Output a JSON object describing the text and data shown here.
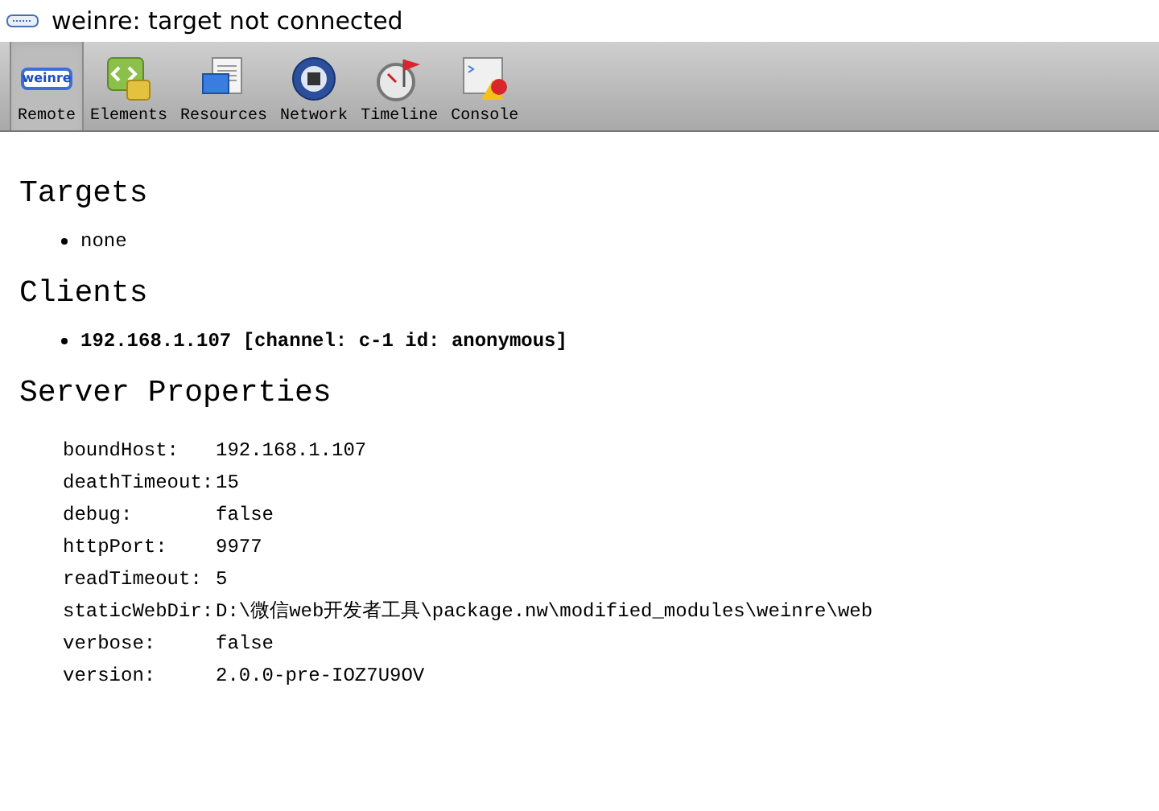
{
  "window": {
    "title": "weinre: target not connected"
  },
  "toolbar": [
    {
      "label": "Remote",
      "kind": "remote",
      "selected": true
    },
    {
      "label": "Elements",
      "kind": "elements",
      "selected": false
    },
    {
      "label": "Resources",
      "kind": "resources",
      "selected": false
    },
    {
      "label": "Network",
      "kind": "network",
      "selected": false
    },
    {
      "label": "Timeline",
      "kind": "timeline",
      "selected": false
    },
    {
      "label": "Console",
      "kind": "console",
      "selected": false
    }
  ],
  "remote_icon_text": "weinre",
  "targets": {
    "heading": "Targets",
    "items": [
      "none"
    ]
  },
  "clients": {
    "heading": "Clients",
    "items": [
      "192.168.1.107 [channel: c-1 id: anonymous]"
    ]
  },
  "server_properties": {
    "heading": "Server Properties",
    "rows": [
      {
        "name": "boundHost:",
        "value": "192.168.1.107"
      },
      {
        "name": "deathTimeout:",
        "value": "15"
      },
      {
        "name": "debug:",
        "value": "false"
      },
      {
        "name": "httpPort:",
        "value": "9977"
      },
      {
        "name": "readTimeout:",
        "value": "5"
      },
      {
        "name": "staticWebDir:",
        "value": "D:\\微信web开发者工具\\package.nw\\modified_modules\\weinre\\web"
      },
      {
        "name": "verbose:",
        "value": "false"
      },
      {
        "name": "version:",
        "value": "2.0.0-pre-IOZ7U9OV"
      }
    ]
  }
}
